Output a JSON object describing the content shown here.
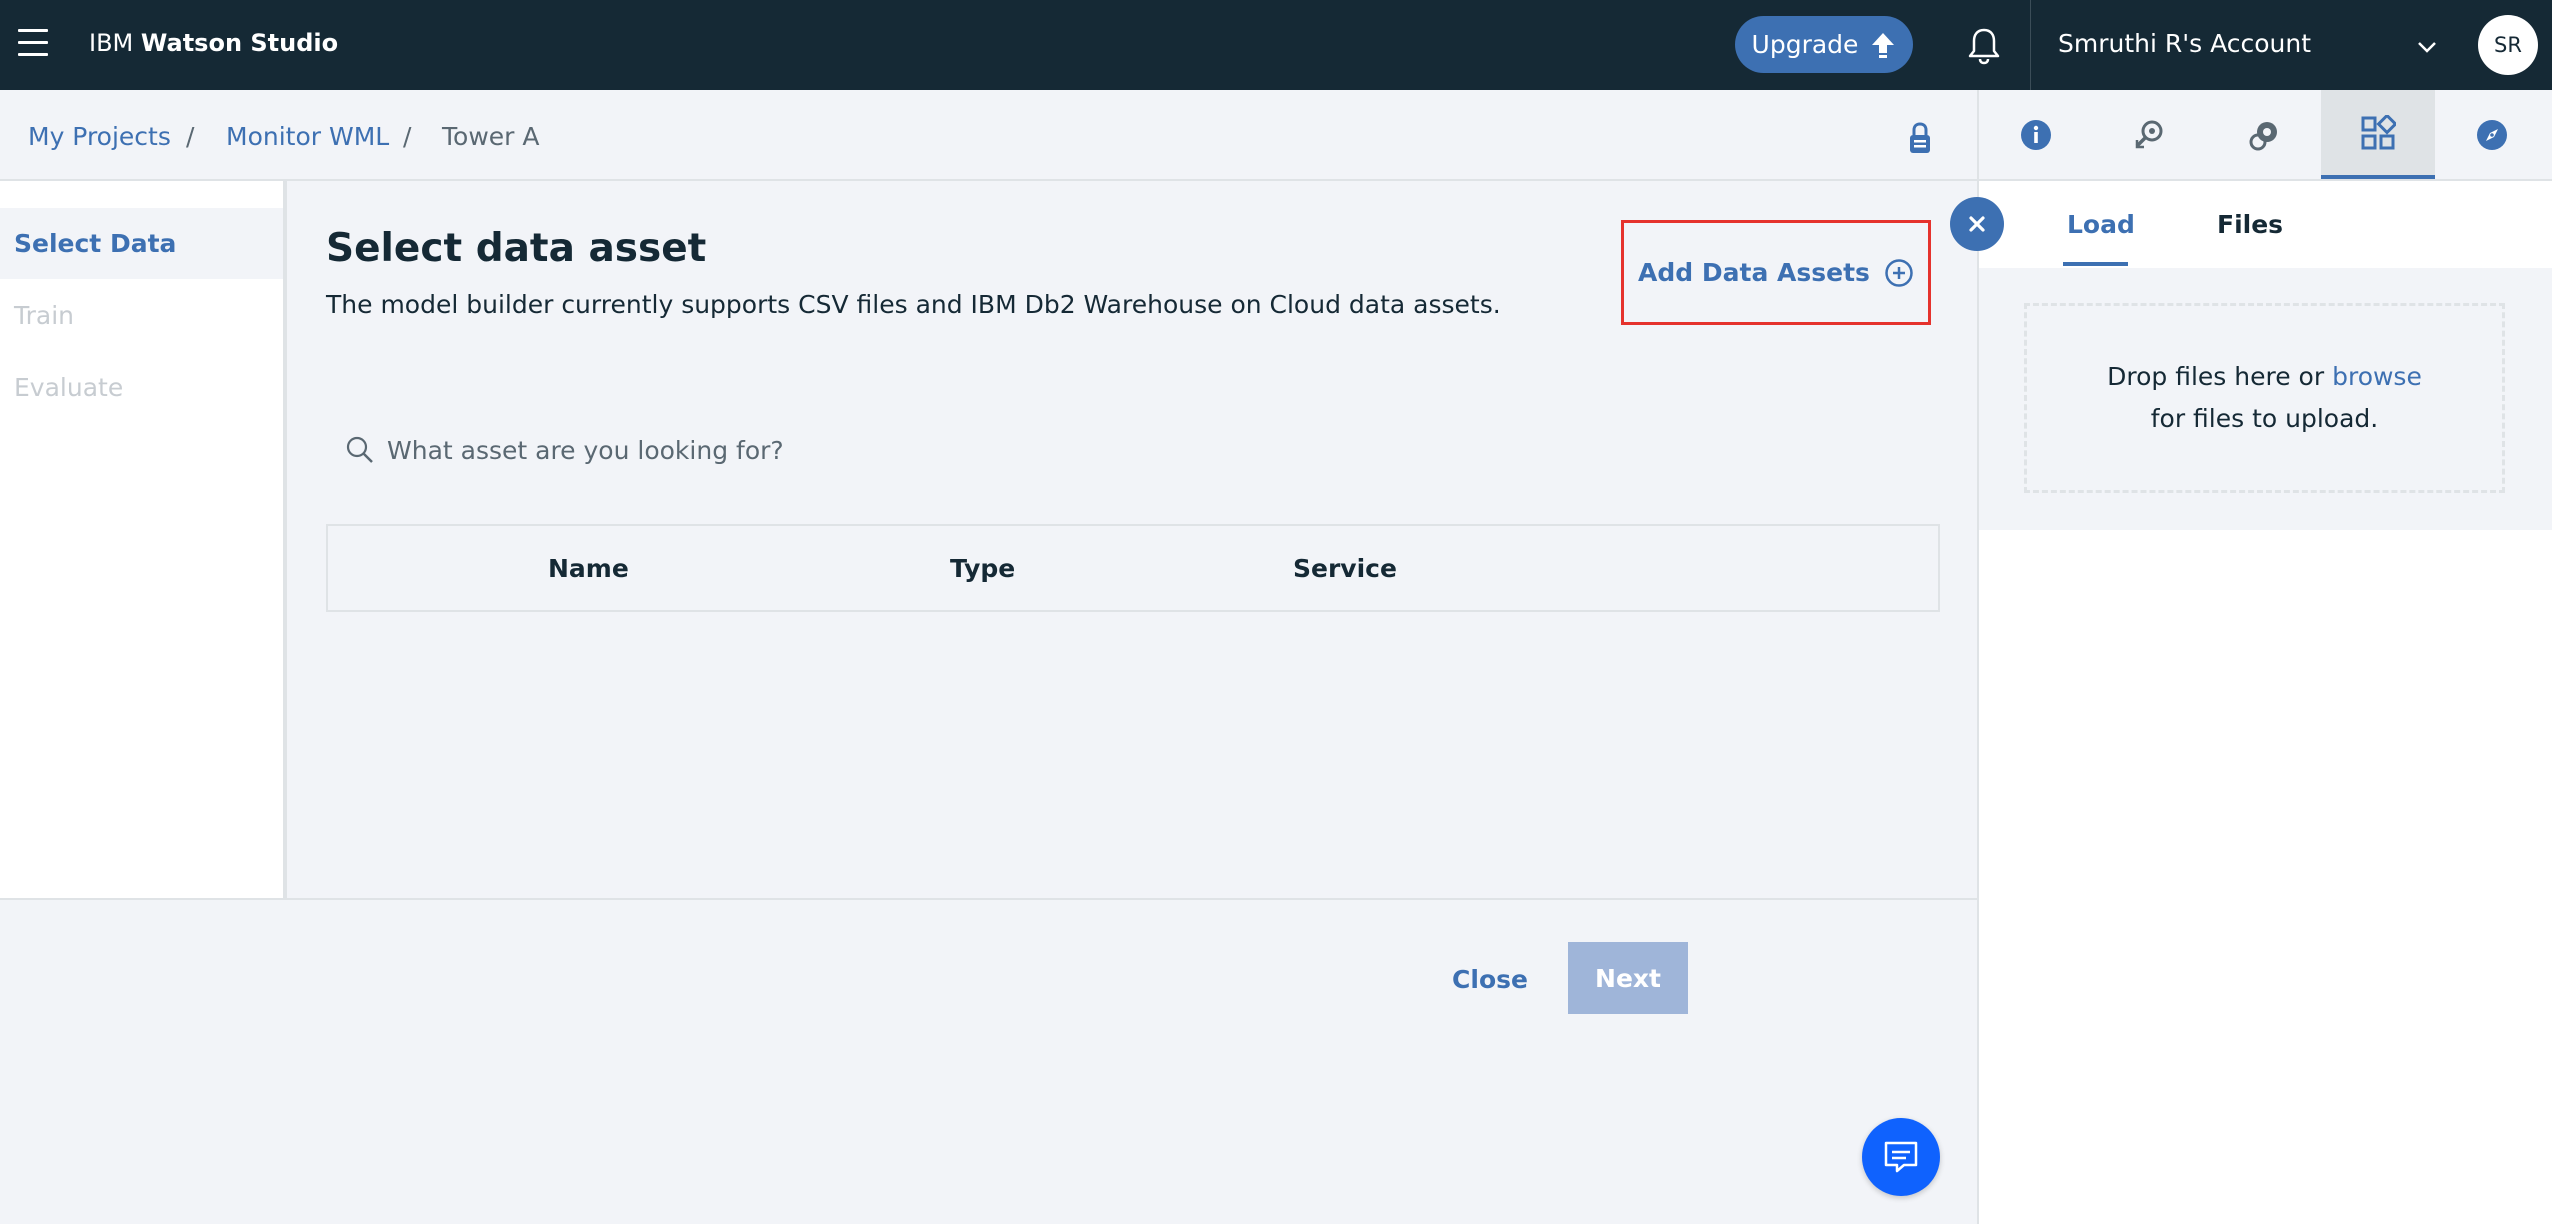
{
  "topbar": {
    "brand_light": "IBM",
    "brand_bold": "Watson Studio",
    "upgrade_label": "Upgrade",
    "account_name": "Smruthi R's Account",
    "avatar_initials": "SR"
  },
  "breadcrumb": {
    "items": [
      "My Projects",
      "Monitor WML",
      "Tower A"
    ],
    "separator": "/"
  },
  "steps": {
    "items": [
      {
        "label": "Select Data",
        "state": "active"
      },
      {
        "label": "Train",
        "state": "disabled"
      },
      {
        "label": "Evaluate",
        "state": "disabled"
      }
    ]
  },
  "main": {
    "title": "Select data asset",
    "description": "The model builder currently supports CSV files and IBM Db2 Warehouse on Cloud data assets.",
    "add_assets_label": "Add Data Assets",
    "search_placeholder": "What asset are you looking for?",
    "table_headers": [
      "Name",
      "Type",
      "Service"
    ],
    "close_label": "Close",
    "next_label": "Next"
  },
  "right_panel": {
    "tabs": [
      "Load",
      "Files"
    ],
    "active_tab": "Load",
    "drop_text_before": "Drop files here or",
    "drop_link": "browse",
    "drop_text_after": "for files to upload.",
    "icons": [
      "info-icon",
      "find-icon",
      "community-icon",
      "data-icon",
      "compass-icon"
    ],
    "active_icon": "data-icon"
  },
  "colors": {
    "topbar": "#152935",
    "accent": "#3d70b2",
    "highlight_border": "#e5322d",
    "chat_fab": "#0f62fe",
    "next_disabled": "#9fb5d9"
  }
}
